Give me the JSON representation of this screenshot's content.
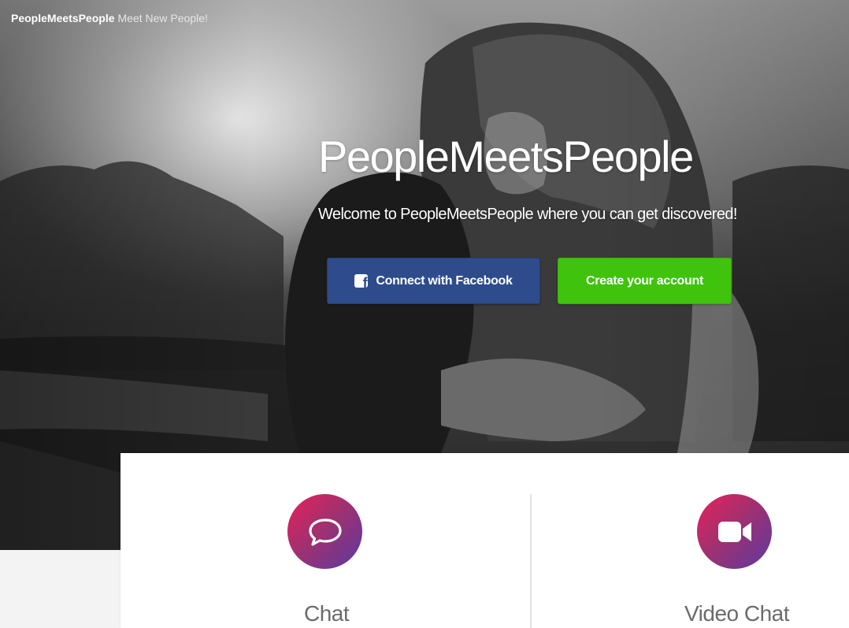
{
  "header": {
    "brand_name": "PeopleMeetsPeople",
    "tagline": "Meet New People!"
  },
  "hero": {
    "title": "PeopleMeetsPeople",
    "subtitle": "Welcome to PeopleMeetsPeople where you can get discovered!",
    "facebook_button": "Connect with Facebook",
    "create_account_button": "Create your account"
  },
  "features": [
    {
      "label": "Chat",
      "icon": "chat-bubble-icon"
    },
    {
      "label": "Video Chat",
      "icon": "video-camera-icon"
    }
  ],
  "colors": {
    "facebook": "#2e4c8c",
    "create_account": "#3fc30c",
    "feature_gradient_start": "#e8215c",
    "feature_gradient_end": "#5a3aa0"
  }
}
